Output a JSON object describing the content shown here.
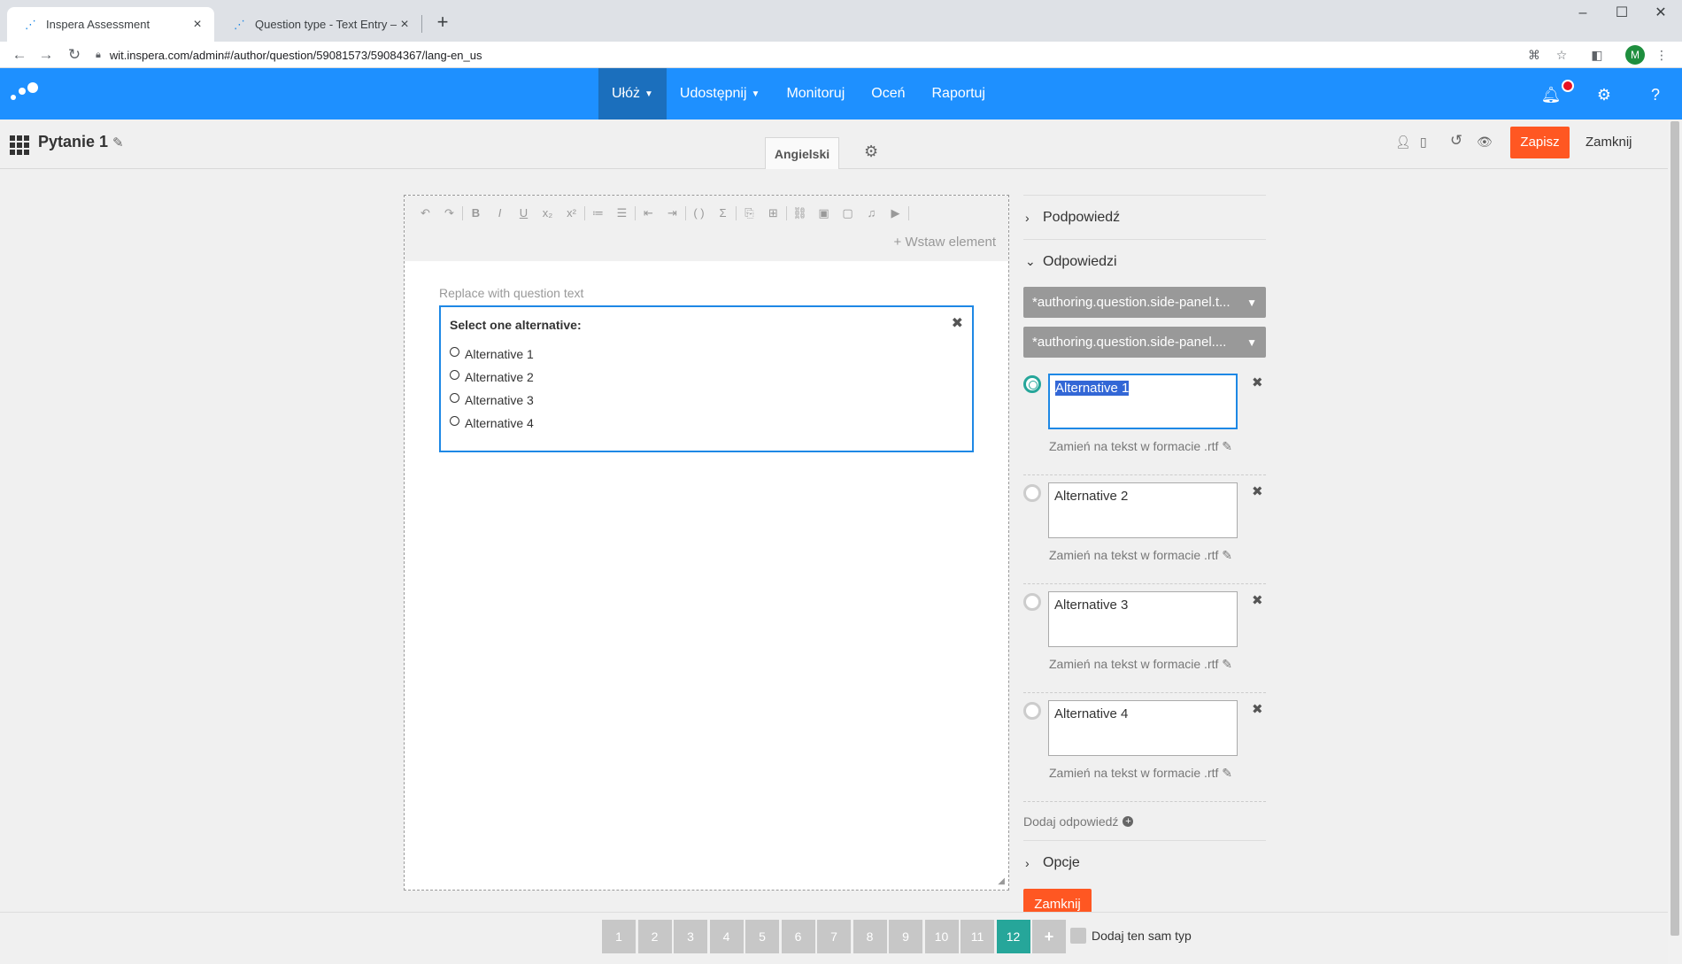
{
  "browser": {
    "tabs": [
      {
        "title": "Inspera Assessment"
      },
      {
        "title": "Question type - Text Entry – Insp"
      }
    ],
    "url": "wit.inspera.com/admin#/author/question/59081573/59084367/lang-en_us",
    "profile_initial": "M"
  },
  "nav": {
    "items": [
      {
        "label": "Ułóż"
      },
      {
        "label": "Udostępnij"
      },
      {
        "label": "Monitoruj"
      },
      {
        "label": "Oceń"
      },
      {
        "label": "Raportuj"
      }
    ]
  },
  "subheader": {
    "title": "Pytanie 1",
    "language": "Angielski",
    "save": "Zapisz",
    "close": "Zamknij"
  },
  "editor": {
    "insert_element": "Wstaw element",
    "placeholder": "Replace with question text",
    "alt_title": "Select one alternative:",
    "alternatives": [
      "Alternative 1",
      "Alternative 2",
      "Alternative 3",
      "Alternative 4"
    ]
  },
  "side": {
    "hint": "Podpowiedź",
    "answers": "Odpowiedzi",
    "dropdown1": "*authoring.question.side-panel.t...",
    "dropdown2": "*authoring.question.side-panel....",
    "answer_items": [
      {
        "text": "Alternative 1",
        "rtf": "Zamień na tekst w formacie .rtf"
      },
      {
        "text": "Alternative 2",
        "rtf": "Zamień na tekst w formacie .rtf"
      },
      {
        "text": "Alternative 3",
        "rtf": "Zamień na tekst w formacie .rtf"
      },
      {
        "text": "Alternative 4",
        "rtf": "Zamień na tekst w formacie .rtf"
      }
    ],
    "add_answer": "Dodaj odpowiedź",
    "options": "Opcje",
    "close": "Zamknij"
  },
  "footer": {
    "pages": [
      "1",
      "2",
      "3",
      "4",
      "5",
      "6",
      "7",
      "8",
      "9",
      "10",
      "11",
      "12"
    ],
    "active_page": "12",
    "add_same_type": "Dodaj ten sam typ"
  },
  "colors": {
    "brand_blue": "#1e90ff",
    "accent_orange": "#ff5722",
    "teal": "#26a69a"
  }
}
